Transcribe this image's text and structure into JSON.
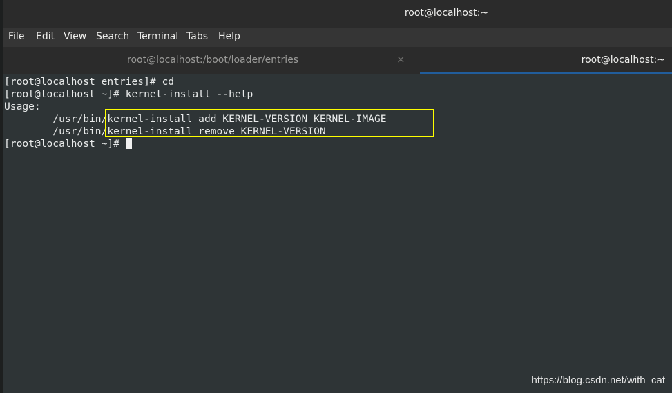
{
  "window": {
    "title": "root@localhost:~"
  },
  "menu": {
    "items": [
      "File",
      "Edit",
      "View",
      "Search",
      "Terminal",
      "Tabs",
      "Help"
    ]
  },
  "tabs": [
    {
      "label": "root@localhost:/boot/loader/entries",
      "active": false,
      "close_glyph": "×"
    },
    {
      "label": "root@localhost:~",
      "active": true
    }
  ],
  "terminal": {
    "lines": [
      "[root@localhost entries]# cd",
      "[root@localhost ~]# kernel-install --help",
      "Usage:",
      "        /usr/bin/kernel-install add KERNEL-VERSION KERNEL-IMAGE",
      "        /usr/bin/kernel-install remove KERNEL-VERSION",
      "[root@localhost ~]# "
    ],
    "highlight_color": "#ffff00"
  },
  "watermark": {
    "text": "https://blog.csdn.net/with_cat"
  },
  "colors": {
    "terminal_bg": "#2e3436",
    "terminal_fg": "#e8eaea",
    "active_tab_underline": "#215d9c"
  }
}
